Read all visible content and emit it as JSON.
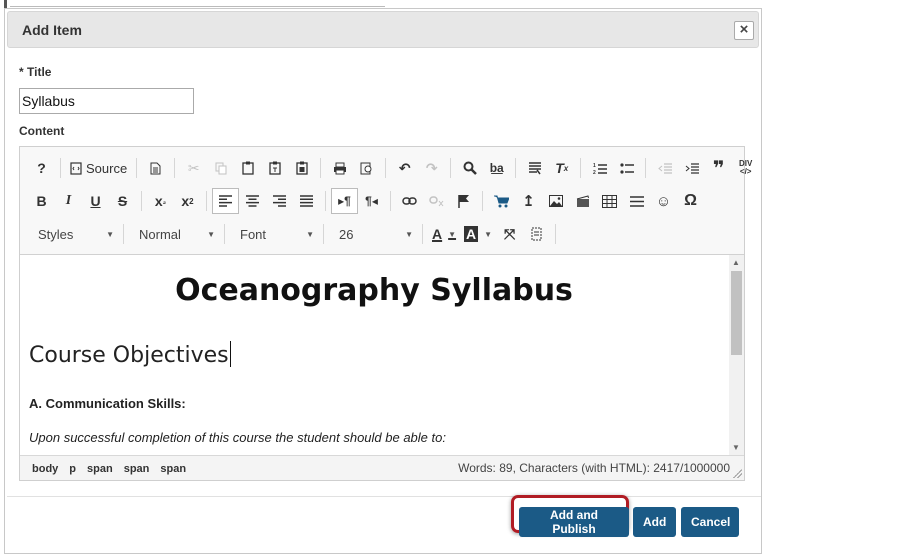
{
  "dialog": {
    "title": "Add Item",
    "close_label": "×",
    "title_field": {
      "label": "* Title",
      "value": "Syllabus"
    },
    "content_label": "Content"
  },
  "editor": {
    "toolbar": {
      "source_label": "Source",
      "styles_combo": "Styles",
      "format_combo": "Normal",
      "font_combo": "Font",
      "size_combo": "26"
    },
    "content": {
      "heading": "Oceanography Syllabus",
      "subheading": "Course Objectives",
      "section": "A.  Communication Skills:",
      "paragraph": "Upon successful completion of this course the student should be able to:"
    },
    "status": {
      "path": [
        "body",
        "p",
        "span",
        "span",
        "span"
      ],
      "wordcount": "Words: 89, Characters (with HTML): 2417/1000000"
    }
  },
  "buttons": {
    "add_publish": "Add and Publish",
    "add": "Add",
    "cancel": "Cancel"
  },
  "colors": {
    "primary_button": "#1b5a86",
    "highlight": "#b11c24"
  }
}
